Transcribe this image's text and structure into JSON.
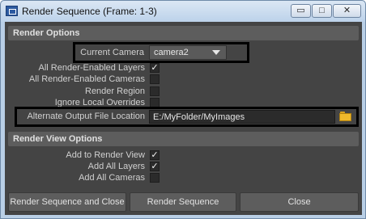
{
  "window": {
    "title": "Render Sequence (Frame: 1-3)",
    "controls": {
      "minimize": "▭",
      "maximize": "□",
      "close": "✕"
    }
  },
  "render_options": {
    "header": "Render Options",
    "current_camera": {
      "label": "Current Camera",
      "value": "camera2"
    },
    "all_render_enabled_layers": {
      "label": "All Render-Enabled Layers",
      "checked": true
    },
    "all_render_enabled_cameras": {
      "label": "All Render-Enabled Cameras",
      "checked": false
    },
    "render_region": {
      "label": "Render Region",
      "checked": false
    },
    "ignore_local_overrides": {
      "label": "Ignore Local Overrides",
      "checked": false
    },
    "alternate_output": {
      "label": "Alternate Output File Location",
      "value": "E:/MyFolder/MyImages",
      "icon": "folder-icon"
    }
  },
  "render_view_options": {
    "header": "Render View Options",
    "add_to_render_view": {
      "label": "Add to Render View",
      "checked": true
    },
    "add_all_layers": {
      "label": "Add All Layers",
      "checked": true
    },
    "add_all_cameras": {
      "label": "Add All Cameras",
      "checked": false
    }
  },
  "buttons": {
    "render_sequence_and_close": "Render Sequence and Close",
    "render_sequence": "Render Sequence",
    "close": "Close"
  },
  "check_mark": "✓"
}
